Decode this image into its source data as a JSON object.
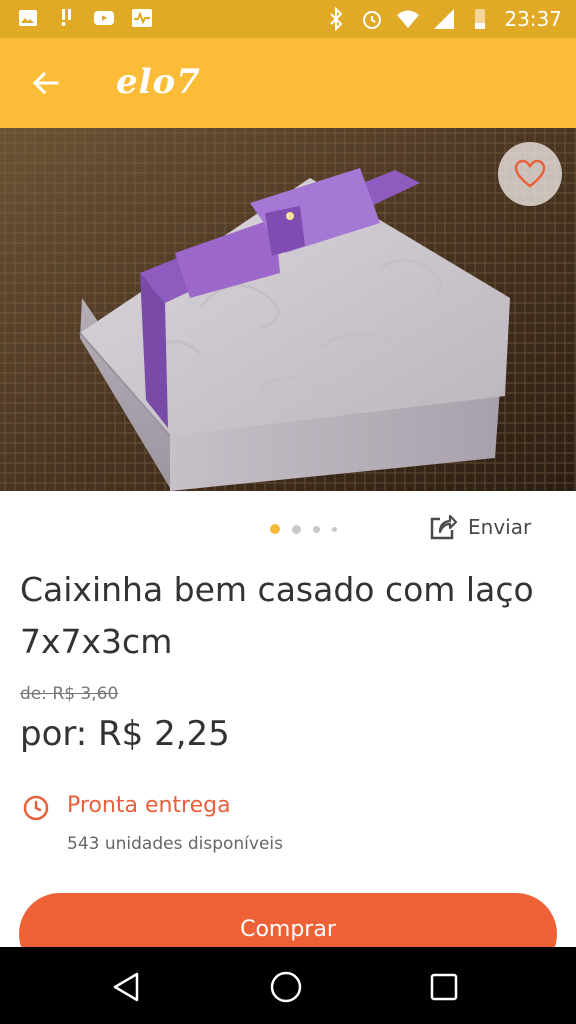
{
  "status_bar": {
    "time": "23:37",
    "background": "#e0aa26"
  },
  "app_bar": {
    "logo": "elo7",
    "background": "#fbbd37"
  },
  "product": {
    "image_count": 4,
    "active_image_index": 0,
    "share_label": "Enviar",
    "title": "Caixinha bem casado com laço 7x7x3cm",
    "old_price": "de: R$ 3,60",
    "price": "por: R$ 2,25",
    "availability_label": "Pronta entrega",
    "stock_label": "543 unidades disponíveis",
    "buy_label": "Comprar"
  },
  "colors": {
    "accent": "#ee6137",
    "brand_yellow": "#fbbd37",
    "dot_active": "#f6b838",
    "dot_inactive": "#c8c8c8"
  },
  "icons": {
    "back": "arrow-left-icon",
    "favorite": "heart-icon",
    "share": "share-icon",
    "clock": "clock-icon"
  }
}
